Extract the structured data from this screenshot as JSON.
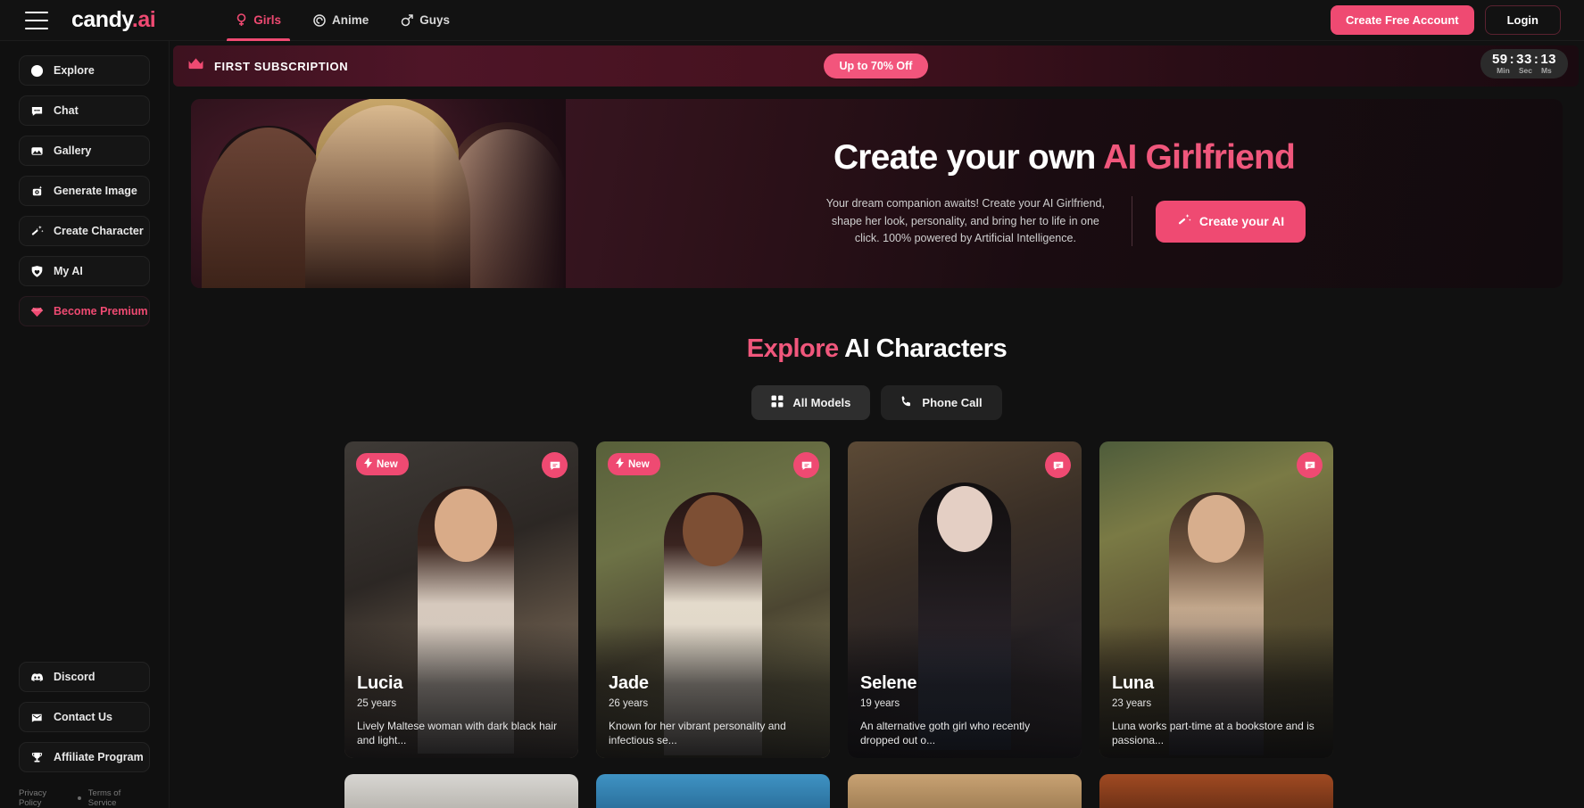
{
  "brand": {
    "name": "candy",
    "suffix": ".ai"
  },
  "nav": {
    "tabs": [
      {
        "label": "Girls",
        "icon": "venus-icon",
        "active": true
      },
      {
        "label": "Anime",
        "icon": "spiral-icon",
        "active": false
      },
      {
        "label": "Guys",
        "icon": "mars-icon",
        "active": false
      }
    ],
    "create_account_label": "Create Free Account",
    "login_label": "Login"
  },
  "sidebar": {
    "top_items": [
      {
        "label": "Explore",
        "icon": "compass-icon"
      },
      {
        "label": "Chat",
        "icon": "chat-bubble-icon"
      },
      {
        "label": "Gallery",
        "icon": "gallery-icon"
      },
      {
        "label": "Generate Image",
        "icon": "generate-image-icon"
      },
      {
        "label": "Create Character",
        "icon": "magic-wand-icon"
      },
      {
        "label": "My AI",
        "icon": "heart-shield-icon"
      },
      {
        "label": "Become Premium",
        "icon": "diamond-icon"
      }
    ],
    "bottom_items": [
      {
        "label": "Discord",
        "icon": "discord-icon"
      },
      {
        "label": "Contact Us",
        "icon": "envelope-icon"
      },
      {
        "label": "Affiliate Program",
        "icon": "trophy-icon"
      }
    ],
    "legal": {
      "privacy": "Privacy Policy",
      "terms": "Terms of Service"
    }
  },
  "promo": {
    "title": "FIRST SUBSCRIPTION",
    "icon": "crown-icon",
    "offer_label": "Up to 70% Off",
    "timer": {
      "min": "59",
      "sec": "33",
      "ms": "13",
      "sep": ":",
      "min_label": "Min",
      "sec_label": "Sec",
      "ms_label": "Ms"
    }
  },
  "hero": {
    "heading_white": "Create your own ",
    "heading_pink": "AI Girlfriend",
    "subtitle": "Your dream companion awaits! Create your AI Girlfriend, shape her look, personality, and bring her to life in one click. 100% powered by Artificial Intelligence.",
    "cta_label": "Create your AI",
    "cta_icon": "magic-wand-icon"
  },
  "explore": {
    "title_pink": "Explore",
    "title_white": " AI Characters",
    "filters": [
      {
        "label": "All Models",
        "icon": "grid-icon",
        "active": true
      },
      {
        "label": "Phone Call",
        "icon": "phone-icon",
        "active": false
      }
    ]
  },
  "characters": [
    {
      "name": "Lucia",
      "age": "25 years",
      "desc": "Lively Maltese woman with dark black hair and light...",
      "badge": "New",
      "new": true,
      "chat_icon": "chat-bubble-icon"
    },
    {
      "name": "Jade",
      "age": "26 years",
      "desc": "Known for her vibrant personality and infectious se...",
      "badge": "New",
      "new": true,
      "chat_icon": "chat-bubble-icon"
    },
    {
      "name": "Selene",
      "age": "19 years",
      "desc": "An alternative goth girl who recently dropped out o...",
      "badge": "",
      "new": false,
      "chat_icon": "chat-bubble-icon"
    },
    {
      "name": "Luna",
      "age": "23 years",
      "desc": "Luna works part-time at a bookstore and is passiona...",
      "badge": "",
      "new": false,
      "chat_icon": "chat-bubble-icon"
    }
  ],
  "colors": {
    "accent": "#ef4a72",
    "accent_light": "#f0577c",
    "background": "#111111",
    "sidebar_bg": "#101010",
    "topbar_bg": "#121212"
  }
}
